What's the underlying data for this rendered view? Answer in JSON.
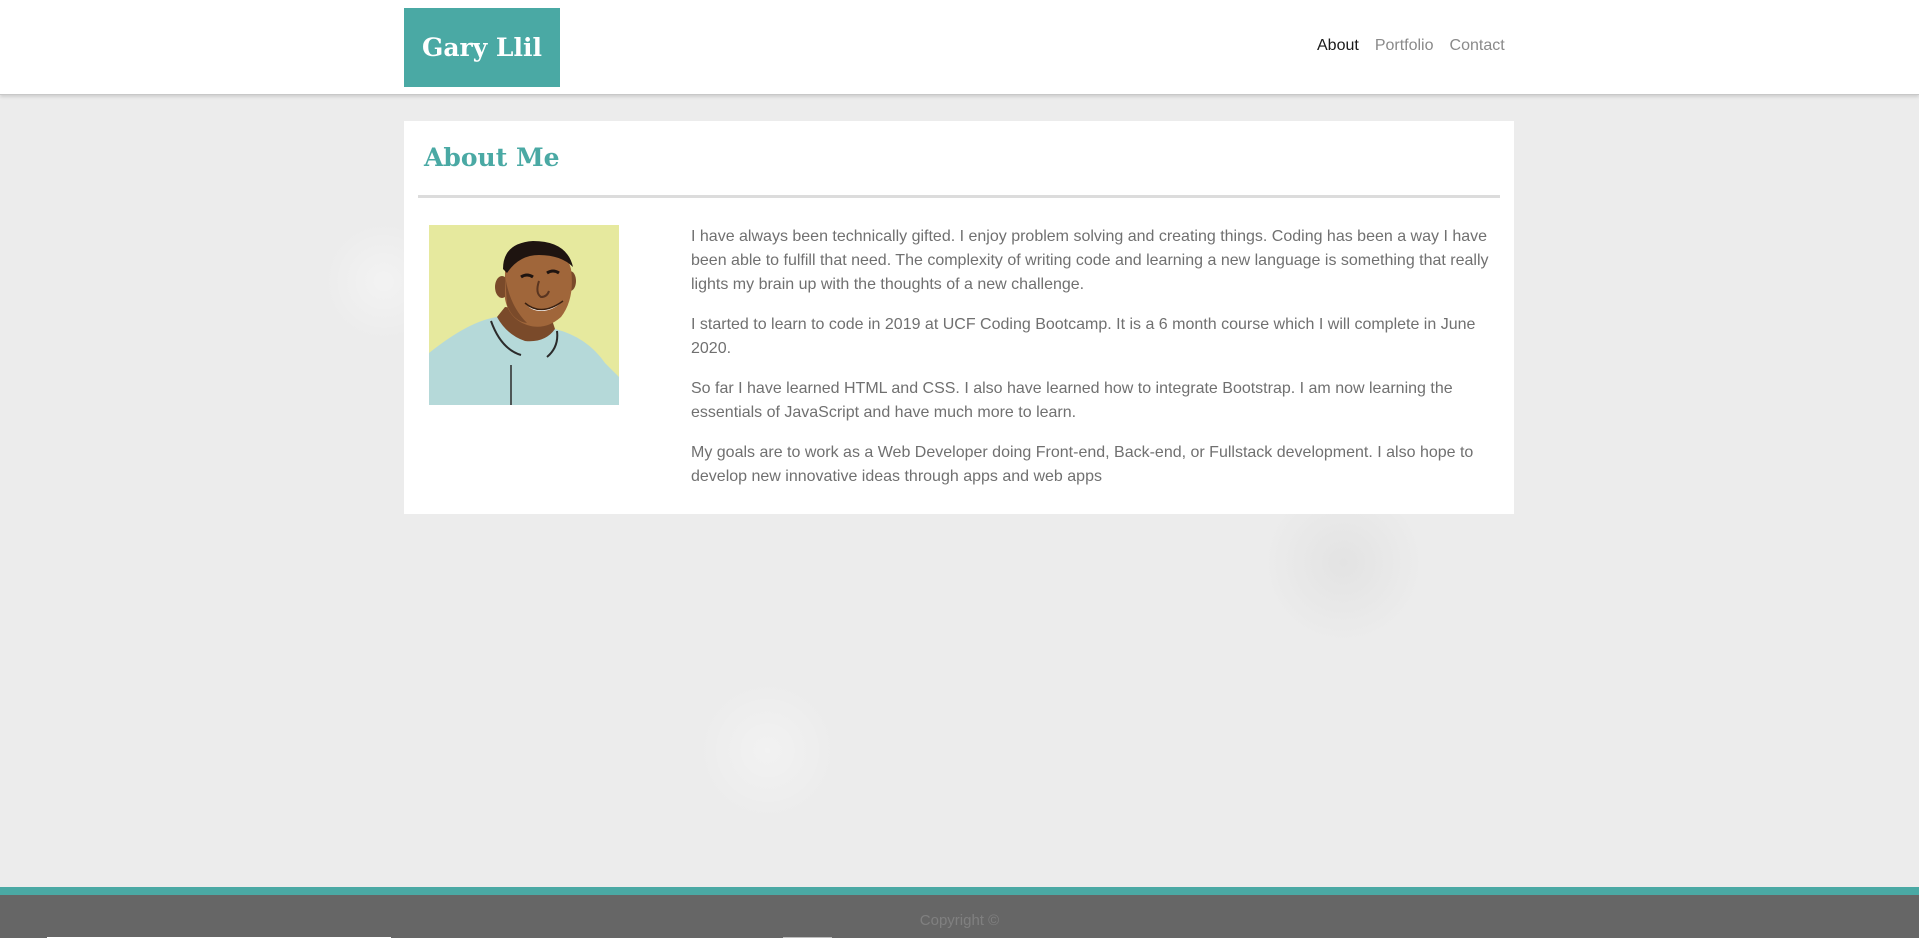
{
  "header": {
    "brand": "Gary Llil",
    "nav": [
      {
        "label": "About",
        "active": true
      },
      {
        "label": "Portfolio",
        "active": false
      },
      {
        "label": "Contact",
        "active": false
      }
    ]
  },
  "about": {
    "title": "About Me",
    "paragraphs": [
      "I have always been technically gifted. I enjoy problem solving and creating things. Coding has been a way I have been able to fulfill that need. The complexity of writing code and learning a new language is something that really lights my brain up with the thoughts of a new challenge.",
      "I started to learn to code in 2019 at UCF Coding Bootcamp. It is a 6 month course which I will complete in June 2020.",
      "So far I have learned HTML and CSS. I also have learned how to integrate Bootstrap. I am now learning the essentials of JavaScript and have much more to learn.",
      "My goals are to work as a Web Developer doing Front-end, Back-end, or Fullstack development. I also hope to develop new innovative ideas through apps and web apps"
    ],
    "avatar_icon": "profile-illustration"
  },
  "footer": {
    "copyright": "Copyright ©"
  },
  "colors": {
    "accent": "#4aa9a4",
    "footer": "#666666",
    "page_background": "#ececec"
  }
}
